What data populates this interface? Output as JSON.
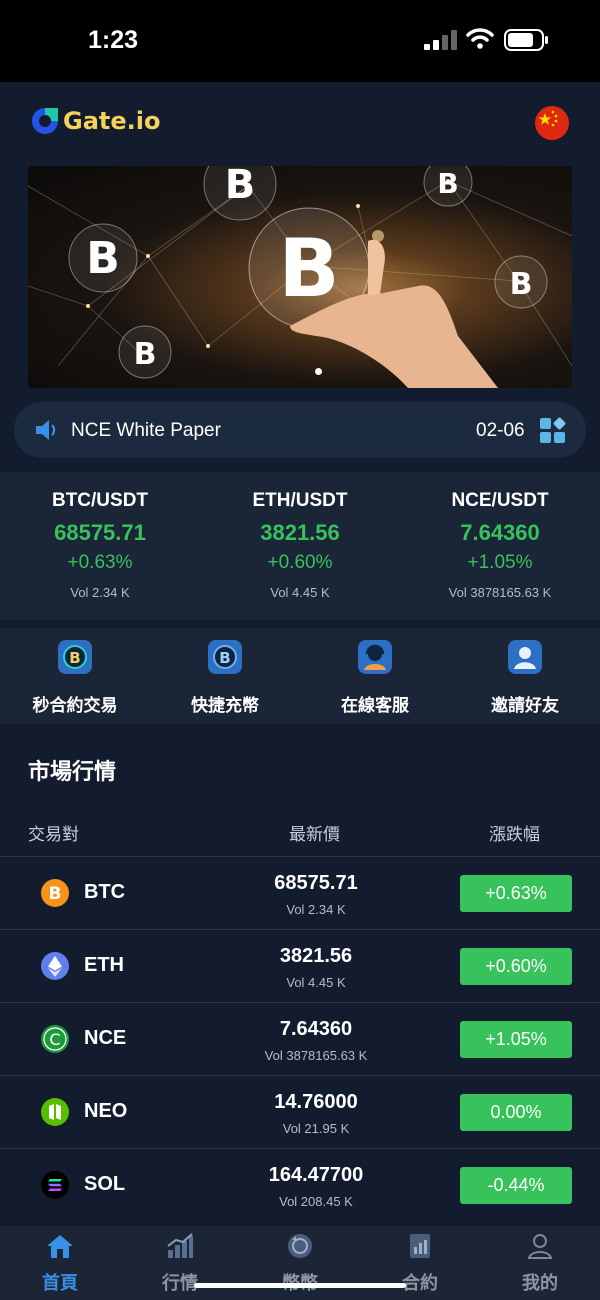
{
  "status_bar": {
    "time": "1:23"
  },
  "header": {
    "logo_text": "Gate.io",
    "flag_icon": "china-flag-icon"
  },
  "notice": {
    "text": "NCE White Paper",
    "date": "02-06"
  },
  "tickers": [
    {
      "pair": "BTC/USDT",
      "price": "68575.71",
      "change": "+0.63%",
      "vol": "Vol 2.34 K"
    },
    {
      "pair": "ETH/USDT",
      "price": "3821.56",
      "change": "+0.60%",
      "vol": "Vol 4.45 K"
    },
    {
      "pair": "NCE/USDT",
      "price": "7.64360",
      "change": "+1.05%",
      "vol": "Vol 3878165.63 K"
    }
  ],
  "shortcuts": [
    {
      "label": "秒合約交易",
      "icon": "bitcoin-exchange-icon"
    },
    {
      "label": "快捷充幣",
      "icon": "bitcoin-deposit-icon"
    },
    {
      "label": "在線客服",
      "icon": "customer-service-icon"
    },
    {
      "label": "邀請好友",
      "icon": "invite-friend-icon"
    }
  ],
  "market": {
    "title": "市場行情",
    "columns": {
      "pair": "交易對",
      "price": "最新價",
      "change": "漲跌幅"
    },
    "rows": [
      {
        "coin": "BTC",
        "price": "68575.71",
        "vol": "Vol 2.34 K",
        "change": "+0.63%",
        "color": "#f7931a"
      },
      {
        "coin": "ETH",
        "price": "3821.56",
        "vol": "Vol 4.45 K",
        "change": "+0.60%",
        "color": "#627eea"
      },
      {
        "coin": "NCE",
        "price": "7.64360",
        "vol": "Vol 3878165.63 K",
        "change": "+1.05%",
        "color": "#1e9a3c"
      },
      {
        "coin": "NEO",
        "price": "14.76000",
        "vol": "Vol 21.95 K",
        "change": "0.00%",
        "color": "#58bf00"
      },
      {
        "coin": "SOL",
        "price": "164.47700",
        "vol": "Vol 208.45 K",
        "change": "-0.44%",
        "color": "#000000"
      }
    ]
  },
  "tabs": [
    {
      "label": "首頁",
      "icon": "home-icon",
      "active": true
    },
    {
      "label": "行情",
      "icon": "market-chart-icon",
      "active": false
    },
    {
      "label": "幣幣",
      "icon": "coin-swap-icon",
      "active": false
    },
    {
      "label": "合約",
      "icon": "contract-icon",
      "active": false
    },
    {
      "label": "我的",
      "icon": "profile-icon",
      "active": false
    }
  ],
  "colors": {
    "up": "#37c25b",
    "accent": "#3a8fe8",
    "background": "#131c2e",
    "logo": "#f5d35b"
  }
}
